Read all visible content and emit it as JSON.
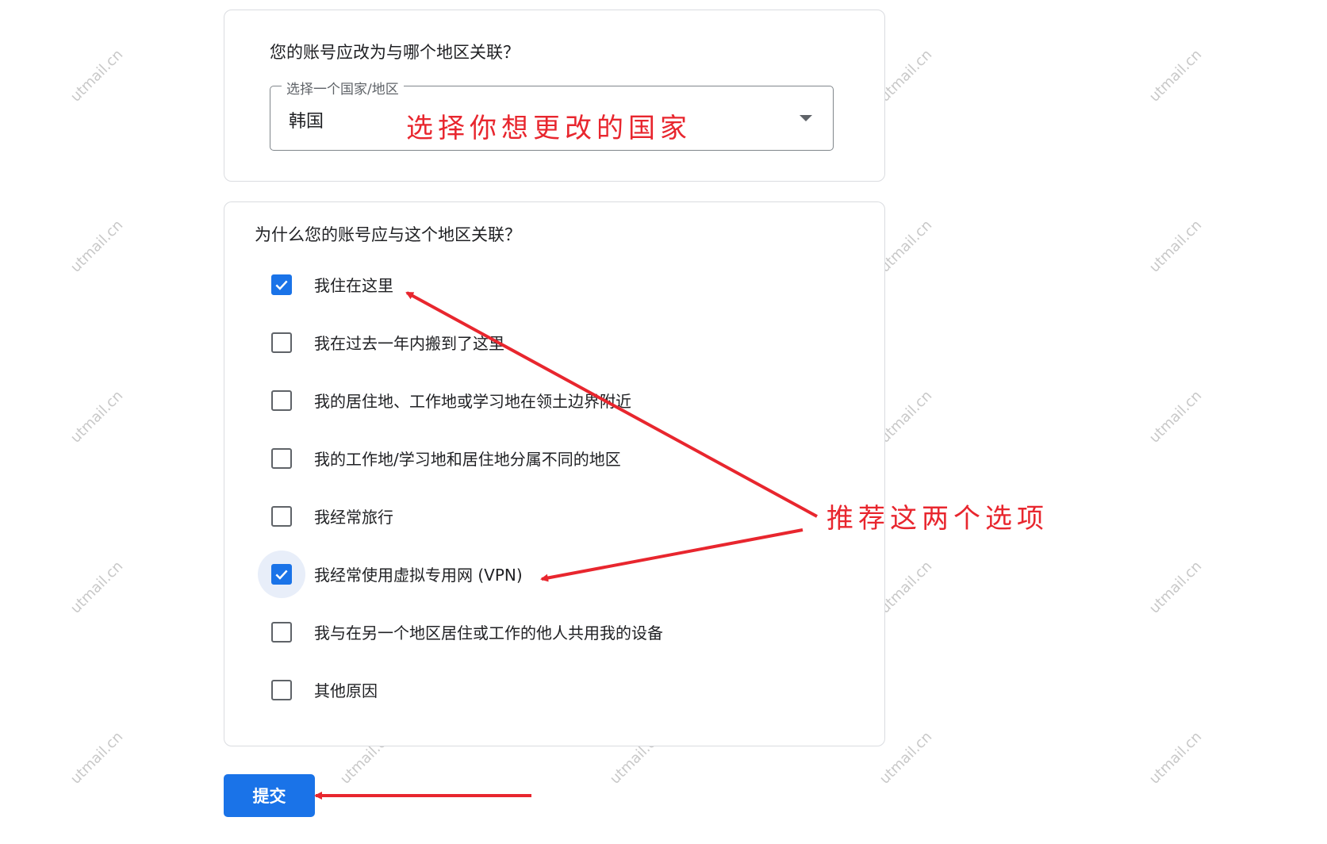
{
  "region_card": {
    "question": "您的账号应改为与哪个地区关联？",
    "select_label": "选择一个国家/地区",
    "select_value": "韩国"
  },
  "reason_card": {
    "question": "为什么您的账号应与这个地区关联？",
    "options": [
      {
        "label": "我住在这里",
        "checked": true
      },
      {
        "label": "我在过去一年内搬到了这里",
        "checked": false
      },
      {
        "label": "我的居住地、工作地或学习地在领土边界附近",
        "checked": false
      },
      {
        "label": "我的工作地/学习地和居住地分属不同的地区",
        "checked": false
      },
      {
        "label": "我经常旅行",
        "checked": false
      },
      {
        "label": "我经常使用虚拟专用网 (VPN)",
        "checked": true,
        "focused": true
      },
      {
        "label": "我与在另一个地区居住或工作的他人共用我的设备",
        "checked": false
      },
      {
        "label": "其他原因",
        "checked": false
      }
    ]
  },
  "submit_label": "提交",
  "annotations": {
    "country_note": "选择你想更改的国家",
    "recommend_note": "推荐这两个选项"
  },
  "watermark_text": "utmail.cn",
  "colors": {
    "accent": "#1a73e8",
    "annotation": "#e8262e"
  }
}
